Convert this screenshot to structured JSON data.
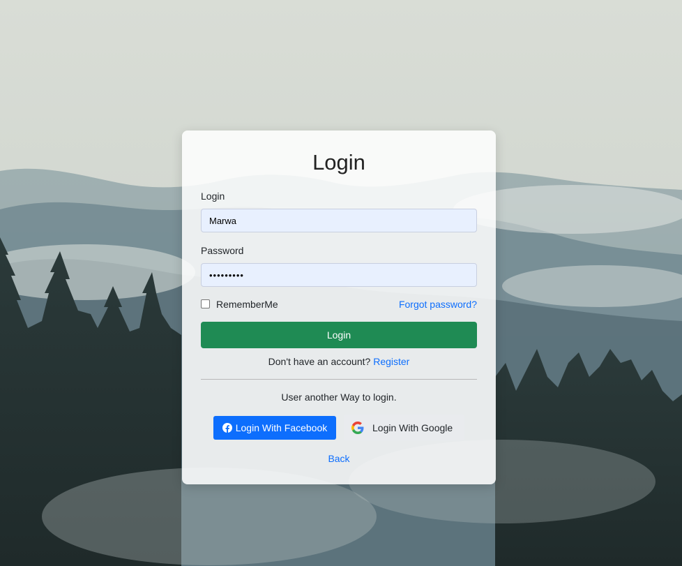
{
  "login_card": {
    "title": "Login",
    "login_label": "Login",
    "login_value": "Marwa",
    "password_label": "Password",
    "password_value": "•••••••••",
    "remember_label": "RememberMe",
    "forgot_link": "Forgot password?",
    "submit_label": "Login",
    "no_account_text": "Don't have an account?",
    "register_link": "Register",
    "other_way_text": "User another Way to login.",
    "facebook_label": "Login With Facebook",
    "google_label": "Login With Google",
    "back_link": "Back"
  },
  "colors": {
    "submit": "#1f8b54",
    "facebook": "#0d6efd",
    "link": "#0d6efd",
    "input_bg": "#e8f0fe"
  },
  "icons": {
    "facebook": "facebook-icon",
    "google": "google-icon"
  }
}
